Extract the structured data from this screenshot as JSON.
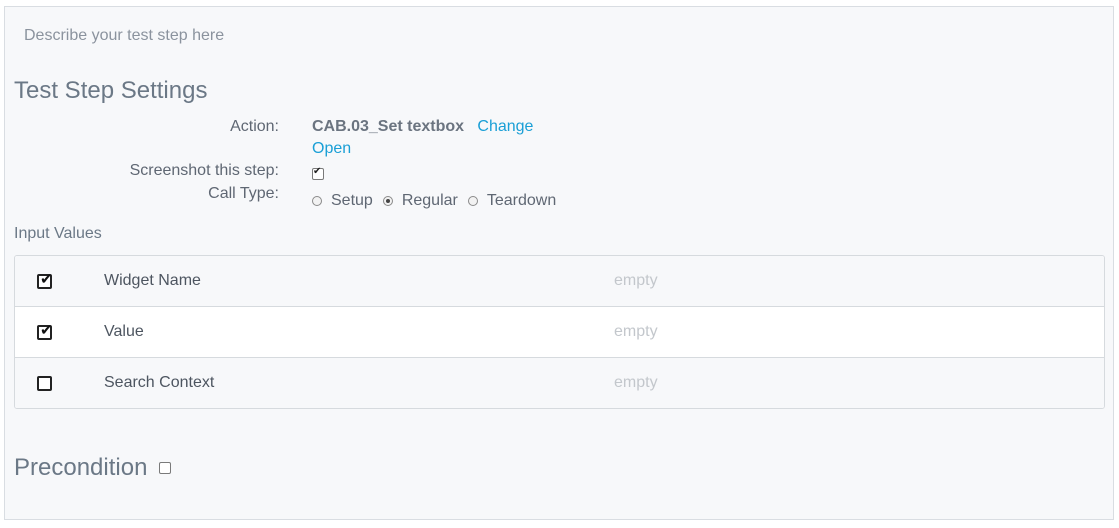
{
  "description": {
    "placeholder": "Describe your test step here"
  },
  "settings": {
    "title": "Test Step Settings",
    "action": {
      "label": "Action:",
      "name": "CAB.03_Set textbox",
      "change_link": "Change",
      "open_link": "Open"
    },
    "screenshot": {
      "label": "Screenshot this step:",
      "checked": true
    },
    "call_type": {
      "label": "Call Type:",
      "options": [
        {
          "label": "Setup",
          "selected": false
        },
        {
          "label": "Regular",
          "selected": true
        },
        {
          "label": "Teardown",
          "selected": false
        }
      ]
    }
  },
  "inputs": {
    "title": "Input Values",
    "rows": [
      {
        "name": "Widget Name",
        "value": "empty",
        "checked": true
      },
      {
        "name": "Value",
        "value": "empty",
        "checked": true
      },
      {
        "name": "Search Context",
        "value": "empty",
        "checked": false
      }
    ]
  },
  "precondition": {
    "title": "Precondition",
    "checked": false
  }
}
